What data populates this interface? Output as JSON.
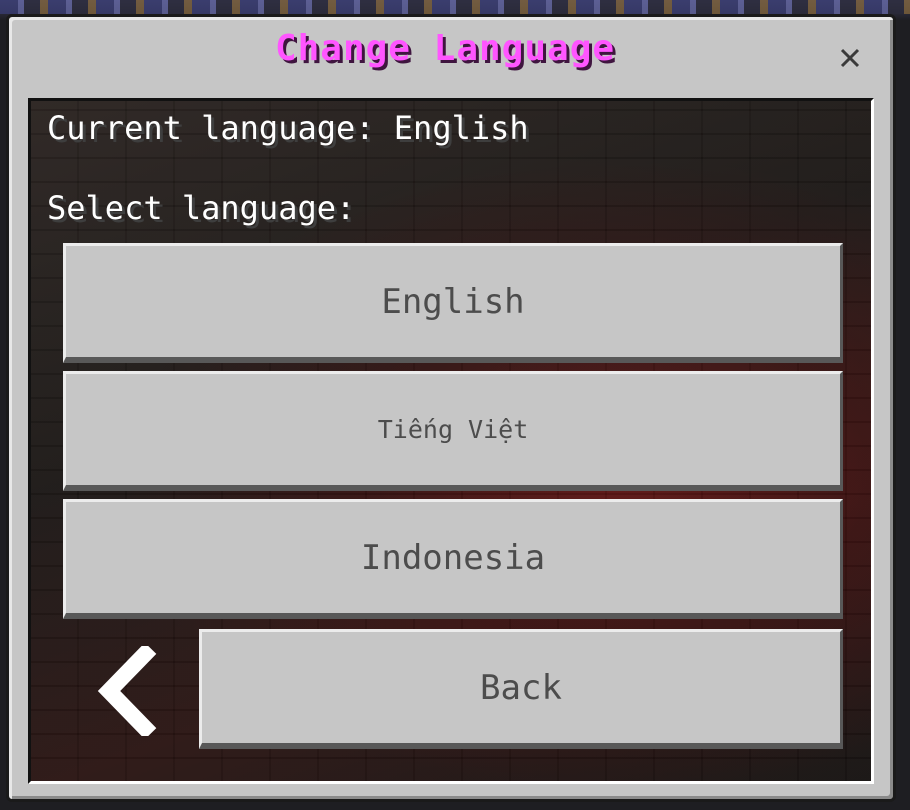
{
  "dialog": {
    "title": "Change Language",
    "title_color": "#ff55ff",
    "close_icon": "close-icon"
  },
  "current_language_label": "Current language: English",
  "select_language_label": "Select language:",
  "languages": [
    {
      "label": "English"
    },
    {
      "label": "Tiếng Việt"
    },
    {
      "label": "Indonesia"
    }
  ],
  "back": {
    "label": "Back",
    "icon": "chevron-left-icon"
  }
}
